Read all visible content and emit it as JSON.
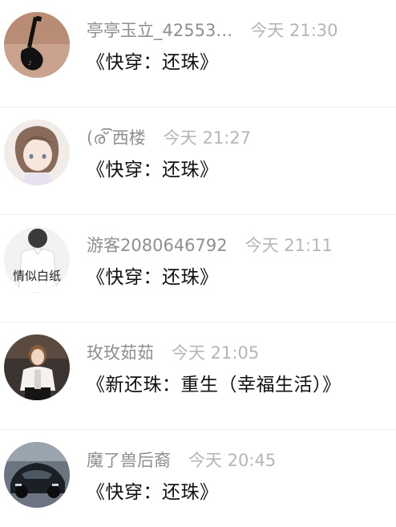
{
  "messages": [
    {
      "username": "亭亭玉立_42553…",
      "time": "今天 21:30",
      "content": "《快穿：还珠》",
      "avatar_icon": "guitar-tattoo-avatar"
    },
    {
      "username": "(ര്͡͡͡ 西楼",
      "time": "今天 21:27",
      "content": "《快穿：还珠》",
      "avatar_icon": "anime-girl-avatar"
    },
    {
      "username": "游客2080646792",
      "time": "今天 21:11",
      "content": "《快穿：还珠》",
      "avatar_icon": "person-white-shirt-avatar",
      "avatar_caption": "情似白纸"
    },
    {
      "username": "玫玫茹茹",
      "time": "今天 21:05",
      "content": "《新还珠：重生（幸福生活）》",
      "avatar_icon": "woman-photo-avatar"
    },
    {
      "username": "魔了兽后裔",
      "time": "今天 20:45",
      "content": "《快穿：还珠》",
      "avatar_icon": "sports-car-avatar"
    }
  ]
}
